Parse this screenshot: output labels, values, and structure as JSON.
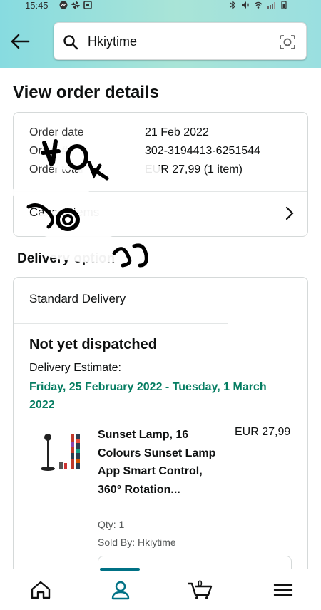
{
  "status_bar": {
    "time": "15:45"
  },
  "search": {
    "query": "Hkiytime"
  },
  "page": {
    "title": "View order details"
  },
  "order": {
    "date_label": "Order date",
    "date_value": "21 Feb 2022",
    "number_label": "Order #",
    "number_value": "302-3194413-6251544",
    "total_label": "Order total",
    "total_value": "EUR 27,99 (1 item)",
    "cancel_label": "Cancel items"
  },
  "delivery": {
    "section_title": "Delivery option",
    "option": "Standard Delivery",
    "status": "Not yet dispatched",
    "estimate_label": "Delivery Estimate:",
    "estimate_dates": "Friday, 25 February 2022 - Tuesday, 1 March 2022",
    "accent_color": "#067d62"
  },
  "product": {
    "title": "Sunset Lamp, 16 Colours Sunset Lamp App Smart Control, 360° Rotation...",
    "price": "EUR 27,99",
    "qty": "Qty: 1",
    "sold_by": "Sold By: Hkiytime"
  },
  "bottom_nav": {
    "items": [
      "home-icon",
      "account-icon",
      "cart-icon",
      "menu-icon"
    ],
    "cart_count": "0",
    "active_color": "#007185"
  }
}
